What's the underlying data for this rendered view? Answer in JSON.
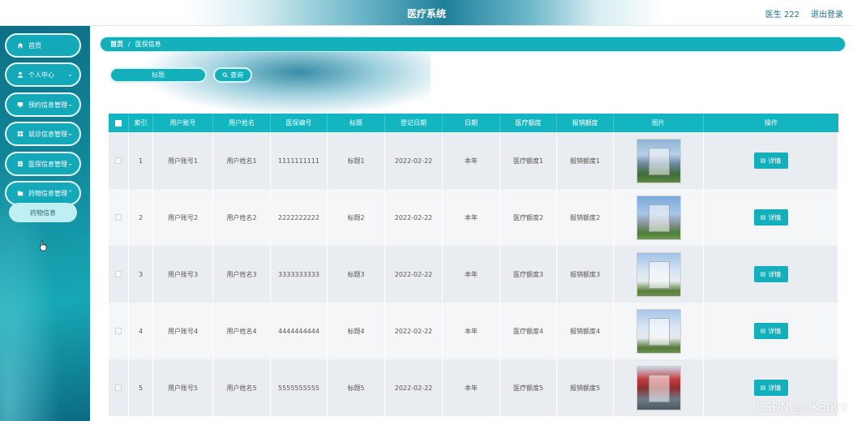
{
  "header": {
    "title": "医疗系统",
    "user": "医生 222",
    "logout": "退出登录"
  },
  "sidebar": {
    "items": [
      {
        "label": "首页",
        "icon": "home-icon",
        "has_children": false
      },
      {
        "label": "个人中心",
        "icon": "user-icon",
        "has_children": true
      },
      {
        "label": "预约信息管理",
        "icon": "monitor-icon",
        "has_children": true
      },
      {
        "label": "就诊信息管理",
        "icon": "grid-icon",
        "has_children": true
      },
      {
        "label": "医保信息管理",
        "icon": "document-icon",
        "has_children": true
      },
      {
        "label": "药物信息管理",
        "icon": "folder-icon",
        "has_children": true
      }
    ],
    "submenu": {
      "label": "药物信息"
    }
  },
  "breadcrumb": {
    "home": "首页",
    "separator": "/",
    "current": "医保信息"
  },
  "search": {
    "placeholder": "标题",
    "button_label": "查询"
  },
  "table": {
    "columns": [
      "索引",
      "用户账号",
      "用户姓名",
      "医保编号",
      "标题",
      "登记日期",
      "日期",
      "医疗额度",
      "报销额度",
      "图片",
      "操作"
    ],
    "rows": [
      {
        "index": "1",
        "account": "用户账号1",
        "name": "用户姓名1",
        "insurance_no": "1111111111",
        "title": "标题1",
        "register_date": "2022-02-22",
        "date": "本年",
        "medical_quota": "医疗额度1",
        "reimburse_quota": "报销额度1",
        "action": "详情"
      },
      {
        "index": "2",
        "account": "用户账号2",
        "name": "用户姓名2",
        "insurance_no": "2222222222",
        "title": "标题2",
        "register_date": "2022-02-22",
        "date": "本年",
        "medical_quota": "医疗额度2",
        "reimburse_quota": "报销额度2",
        "action": "详情"
      },
      {
        "index": "3",
        "account": "用户账号3",
        "name": "用户姓名3",
        "insurance_no": "3333333333",
        "title": "标题3",
        "register_date": "2022-02-22",
        "date": "本年",
        "medical_quota": "医疗额度3",
        "reimburse_quota": "报销额度3",
        "action": "详情"
      },
      {
        "index": "4",
        "account": "用户账号4",
        "name": "用户姓名4",
        "insurance_no": "4444444444",
        "title": "标题4",
        "register_date": "2022-02-22",
        "date": "本年",
        "medical_quota": "医疗额度4",
        "reimburse_quota": "报销额度4",
        "action": "详情"
      },
      {
        "index": "5",
        "account": "用户账号5",
        "name": "用户姓名5",
        "insurance_no": "5555555555",
        "title": "标题5",
        "register_date": "2022-02-22",
        "date": "本年",
        "medical_quota": "医疗额度5",
        "reimburse_quota": "报销额度5",
        "action": "详情"
      }
    ]
  },
  "watermark": "CSDN @CK3028",
  "colors": {
    "accent": "#13b0bb",
    "header_accent": "#1f7f9b",
    "sidebar_dark": "#0e6f86"
  }
}
